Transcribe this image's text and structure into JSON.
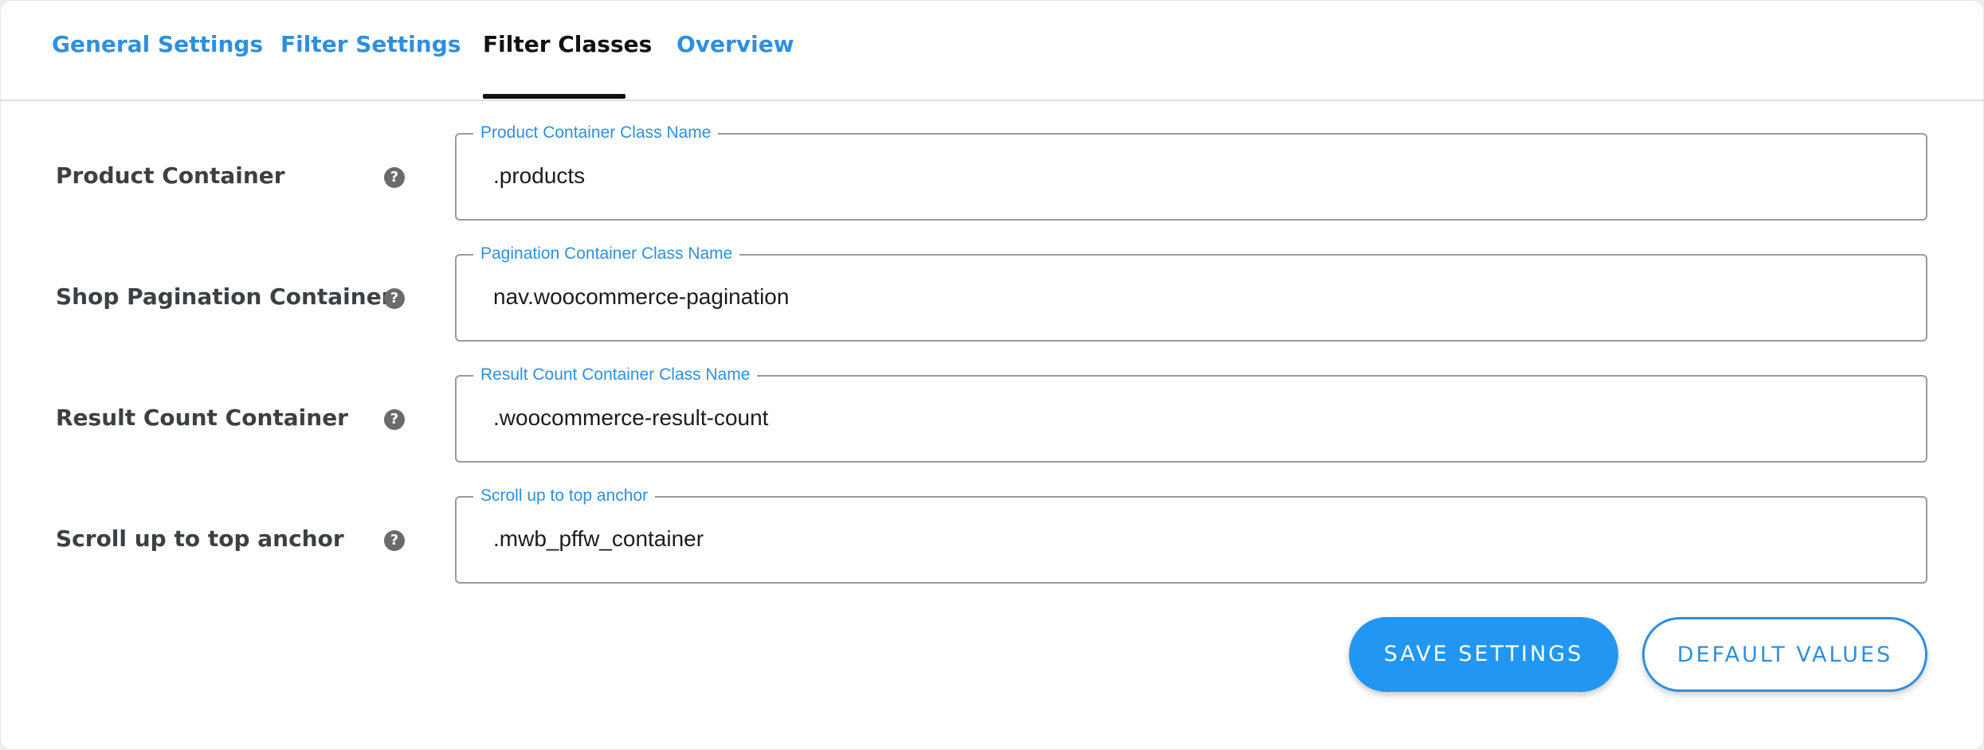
{
  "tabs": [
    {
      "label": "General Settings",
      "active": false
    },
    {
      "label": "Filter Settings",
      "active": false
    },
    {
      "label": "Filter Classes",
      "active": true
    },
    {
      "label": "Overview",
      "active": false
    }
  ],
  "rows": [
    {
      "label": "Product Container",
      "field_legend": "Product Container Class Name",
      "value": ".products"
    },
    {
      "label": "Shop Pagination Container",
      "field_legend": "Pagination Container Class Name",
      "value": "nav.woocommerce-pagination"
    },
    {
      "label": "Result Count Container",
      "field_legend": "Result Count Container Class Name",
      "value": ".woocommerce-result-count"
    },
    {
      "label": "Scroll up to top anchor",
      "field_legend": "Scroll up to top anchor",
      "value": ".mwb_pffw_container"
    }
  ],
  "help_icon_glyph": "?",
  "buttons": {
    "save": "SAVE SETTINGS",
    "defaults": "DEFAULT VALUES"
  },
  "colors": {
    "accent": "#2196f3",
    "link": "#2f8fde",
    "active_tab": "#111111"
  }
}
